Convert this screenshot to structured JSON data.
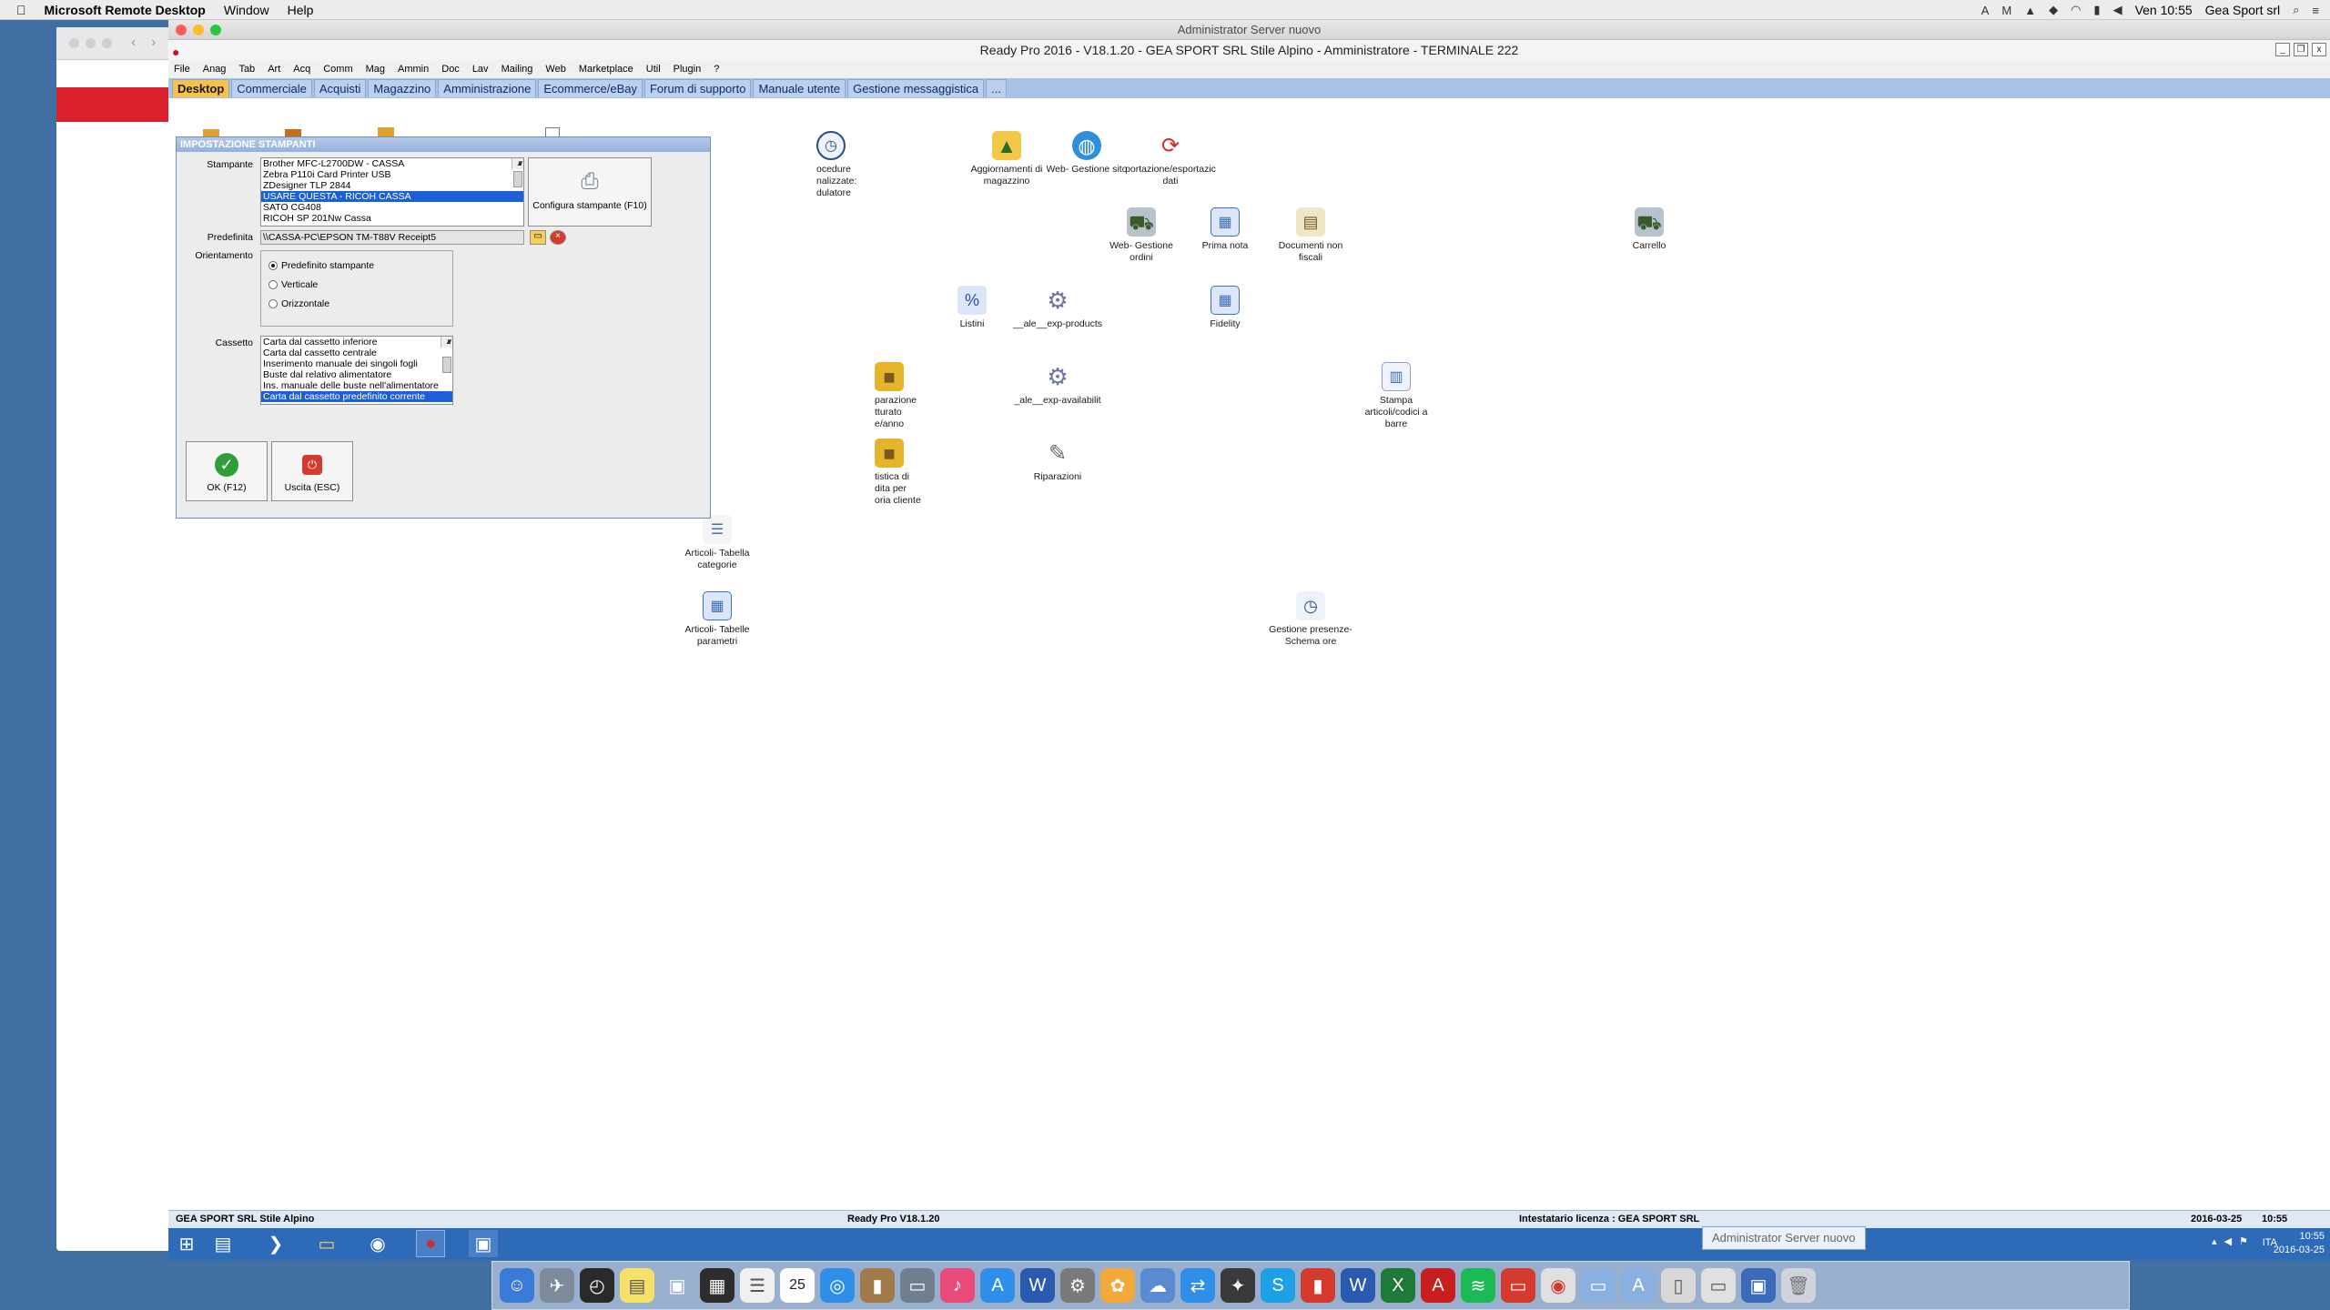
{
  "mac_menubar": {
    "apple": "",
    "app_name": "Microsoft Remote Desktop",
    "items": [
      "Window",
      "Help"
    ],
    "clock": "Ven 10:55",
    "user": "Gea Sport srl"
  },
  "rdp_window": {
    "title": "Administrator Server nuovo"
  },
  "app": {
    "title": "Ready Pro 2016 - V18.1.20 - GEA SPORT SRL Stile Alpino - Amministratore - TERMINALE 222",
    "menu": [
      "File",
      "Anag",
      "Tab",
      "Art",
      "Acq",
      "Comm",
      "Mag",
      "Ammin",
      "Doc",
      "Lav",
      "Mailing",
      "Web",
      "Marketplace",
      "Util",
      "Plugin",
      "?"
    ],
    "tabs": [
      "Desktop",
      "Commerciale",
      "Acquisti",
      "Magazzino",
      "Amministrazione",
      "Ecommerce/eBay",
      "Forum di supporto",
      "Manuale utente",
      "Gestione messaggistica",
      "..."
    ]
  },
  "desktop_icons": [
    {
      "name": "procedure",
      "label": "ocedure\nnalizzate:\ndulatore"
    },
    {
      "name": "aggiornamenti",
      "label": "Aggiornamenti di\nmagazzino"
    },
    {
      "name": "web-gestione-sito",
      "label": "Web- Gestione sito"
    },
    {
      "name": "importazione",
      "label": "portazione/esportazic\ndati"
    },
    {
      "name": "web-gestione-ordini",
      "label": "Web- Gestione\nordini"
    },
    {
      "name": "prima-nota",
      "label": "Prima nota"
    },
    {
      "name": "documenti-non-fiscali",
      "label": "Documenti non\nfiscali"
    },
    {
      "name": "carrello",
      "label": "Carrello"
    },
    {
      "name": "listini",
      "label": "Listini"
    },
    {
      "name": "exp-products",
      "label": "__ale__exp-products"
    },
    {
      "name": "fidelity",
      "label": "Fidelity"
    },
    {
      "name": "comparazione",
      "label": "parazione\ntturato\ne/anno"
    },
    {
      "name": "exp-availability",
      "label": "_ale__exp-availabilit"
    },
    {
      "name": "stampa-articoli",
      "label": "Stampa\narticoli/codici a\nbarre"
    },
    {
      "name": "statistica",
      "label": "tistica di\ndita per\noria cliente"
    },
    {
      "name": "riparazioni",
      "label": "Riparazioni"
    },
    {
      "name": "articoli-categorie",
      "label": "Articoli- Tabella\ncategorie"
    },
    {
      "name": "articoli-parametri",
      "label": "Articoli- Tabelle\nparametri"
    },
    {
      "name": "gestione-presenze",
      "label": "Gestione presenze-\nSchema ore"
    }
  ],
  "dialog": {
    "title": "IMPOSTAZIONE STAMPANTI",
    "stampante_label": "Stampante",
    "printers": [
      "Brother MFC-L2700DW - CASSA",
      "Zebra P110i Card Printer USB",
      "ZDesigner TLP 2844",
      "USARE QUESTA - RICOH CASSA",
      "SATO CG408",
      "RICOH SP 201Nw Cassa"
    ],
    "printer_selected_index": 3,
    "configura_label": "Configura stampante (F10)",
    "predefinita_label": "Predefinita",
    "predefinita_value": "\\\\CASSA-PC\\EPSON TM-T88V Receipt5",
    "orientamento_label": "Orientamento",
    "orientation_options": [
      "Predefinito stampante",
      "Verticale",
      "Orizzontale"
    ],
    "orientation_selected_index": 0,
    "cassetto_label": "Cassetto",
    "trays": [
      "Carta dal cassetto inferiore",
      "Carta dal cassetto centrale",
      "Inserimento manuale dei singoli fogli",
      "Buste dal relativo alimentatore",
      "Ins. manuale delle buste nell'alimentatore",
      "Carta dal cassetto predefinito corrente"
    ],
    "tray_selected_index": 5,
    "ok_label": "OK (F12)",
    "exit_label": "Uscita (ESC)"
  },
  "statusbar": {
    "company": "GEA SPORT SRL Stile Alpino",
    "version": "Ready Pro V18.1.20",
    "license": "Intestatario licenza : GEA SPORT SRL",
    "date": "2016-03-25",
    "time": "10:55"
  },
  "win_taskbar": {
    "tooltip": "Administrator Server nuovo",
    "lang": "ITA",
    "clock_time": "10:55",
    "clock_date": "2016-03-25"
  },
  "colors": {
    "tab_bar": "#a9c3e6",
    "active_tab": "#f7c14a",
    "selection": "#1b60d6",
    "win_taskbar": "#2d6ab8"
  }
}
